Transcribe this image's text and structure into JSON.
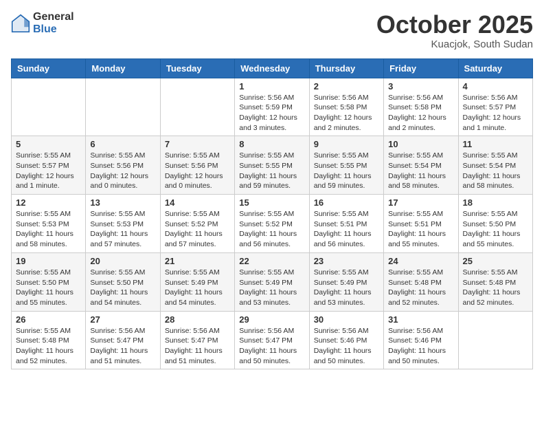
{
  "header": {
    "logo_general": "General",
    "logo_blue": "Blue",
    "month_title": "October 2025",
    "location": "Kuacjok, South Sudan"
  },
  "days_of_week": [
    "Sunday",
    "Monday",
    "Tuesday",
    "Wednesday",
    "Thursday",
    "Friday",
    "Saturday"
  ],
  "weeks": [
    [
      {
        "day": "",
        "info": ""
      },
      {
        "day": "",
        "info": ""
      },
      {
        "day": "",
        "info": ""
      },
      {
        "day": "1",
        "info": "Sunrise: 5:56 AM\nSunset: 5:59 PM\nDaylight: 12 hours and 3 minutes."
      },
      {
        "day": "2",
        "info": "Sunrise: 5:56 AM\nSunset: 5:58 PM\nDaylight: 12 hours and 2 minutes."
      },
      {
        "day": "3",
        "info": "Sunrise: 5:56 AM\nSunset: 5:58 PM\nDaylight: 12 hours and 2 minutes."
      },
      {
        "day": "4",
        "info": "Sunrise: 5:56 AM\nSunset: 5:57 PM\nDaylight: 12 hours and 1 minute."
      }
    ],
    [
      {
        "day": "5",
        "info": "Sunrise: 5:55 AM\nSunset: 5:57 PM\nDaylight: 12 hours and 1 minute."
      },
      {
        "day": "6",
        "info": "Sunrise: 5:55 AM\nSunset: 5:56 PM\nDaylight: 12 hours and 0 minutes."
      },
      {
        "day": "7",
        "info": "Sunrise: 5:55 AM\nSunset: 5:56 PM\nDaylight: 12 hours and 0 minutes."
      },
      {
        "day": "8",
        "info": "Sunrise: 5:55 AM\nSunset: 5:55 PM\nDaylight: 11 hours and 59 minutes."
      },
      {
        "day": "9",
        "info": "Sunrise: 5:55 AM\nSunset: 5:55 PM\nDaylight: 11 hours and 59 minutes."
      },
      {
        "day": "10",
        "info": "Sunrise: 5:55 AM\nSunset: 5:54 PM\nDaylight: 11 hours and 58 minutes."
      },
      {
        "day": "11",
        "info": "Sunrise: 5:55 AM\nSunset: 5:54 PM\nDaylight: 11 hours and 58 minutes."
      }
    ],
    [
      {
        "day": "12",
        "info": "Sunrise: 5:55 AM\nSunset: 5:53 PM\nDaylight: 11 hours and 58 minutes."
      },
      {
        "day": "13",
        "info": "Sunrise: 5:55 AM\nSunset: 5:53 PM\nDaylight: 11 hours and 57 minutes."
      },
      {
        "day": "14",
        "info": "Sunrise: 5:55 AM\nSunset: 5:52 PM\nDaylight: 11 hours and 57 minutes."
      },
      {
        "day": "15",
        "info": "Sunrise: 5:55 AM\nSunset: 5:52 PM\nDaylight: 11 hours and 56 minutes."
      },
      {
        "day": "16",
        "info": "Sunrise: 5:55 AM\nSunset: 5:51 PM\nDaylight: 11 hours and 56 minutes."
      },
      {
        "day": "17",
        "info": "Sunrise: 5:55 AM\nSunset: 5:51 PM\nDaylight: 11 hours and 55 minutes."
      },
      {
        "day": "18",
        "info": "Sunrise: 5:55 AM\nSunset: 5:50 PM\nDaylight: 11 hours and 55 minutes."
      }
    ],
    [
      {
        "day": "19",
        "info": "Sunrise: 5:55 AM\nSunset: 5:50 PM\nDaylight: 11 hours and 55 minutes."
      },
      {
        "day": "20",
        "info": "Sunrise: 5:55 AM\nSunset: 5:50 PM\nDaylight: 11 hours and 54 minutes."
      },
      {
        "day": "21",
        "info": "Sunrise: 5:55 AM\nSunset: 5:49 PM\nDaylight: 11 hours and 54 minutes."
      },
      {
        "day": "22",
        "info": "Sunrise: 5:55 AM\nSunset: 5:49 PM\nDaylight: 11 hours and 53 minutes."
      },
      {
        "day": "23",
        "info": "Sunrise: 5:55 AM\nSunset: 5:49 PM\nDaylight: 11 hours and 53 minutes."
      },
      {
        "day": "24",
        "info": "Sunrise: 5:55 AM\nSunset: 5:48 PM\nDaylight: 11 hours and 52 minutes."
      },
      {
        "day": "25",
        "info": "Sunrise: 5:55 AM\nSunset: 5:48 PM\nDaylight: 11 hours and 52 minutes."
      }
    ],
    [
      {
        "day": "26",
        "info": "Sunrise: 5:55 AM\nSunset: 5:48 PM\nDaylight: 11 hours and 52 minutes."
      },
      {
        "day": "27",
        "info": "Sunrise: 5:56 AM\nSunset: 5:47 PM\nDaylight: 11 hours and 51 minutes."
      },
      {
        "day": "28",
        "info": "Sunrise: 5:56 AM\nSunset: 5:47 PM\nDaylight: 11 hours and 51 minutes."
      },
      {
        "day": "29",
        "info": "Sunrise: 5:56 AM\nSunset: 5:47 PM\nDaylight: 11 hours and 50 minutes."
      },
      {
        "day": "30",
        "info": "Sunrise: 5:56 AM\nSunset: 5:46 PM\nDaylight: 11 hours and 50 minutes."
      },
      {
        "day": "31",
        "info": "Sunrise: 5:56 AM\nSunset: 5:46 PM\nDaylight: 11 hours and 50 minutes."
      },
      {
        "day": "",
        "info": ""
      }
    ]
  ]
}
